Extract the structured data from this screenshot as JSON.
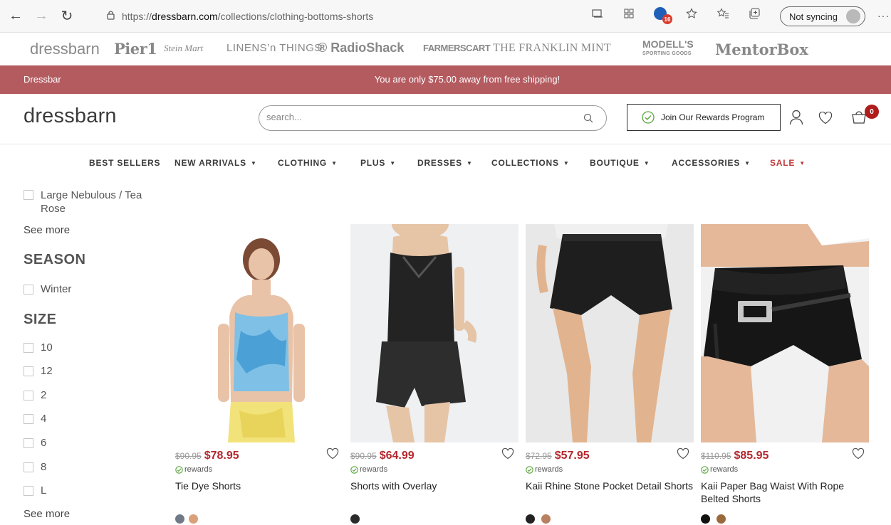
{
  "browser": {
    "url_prefix": "https://",
    "url_domain": "dressbarn.com",
    "url_path": "/collections/clothing-bottoms-shorts",
    "extension_badge": "16",
    "sync_label": "Not syncing",
    "more": "···"
  },
  "brands": [
    "dressbarn",
    "Pier1",
    "Stein Mart",
    "LINENS’n THINGS",
    "® RadioShack",
    "FARMERSCART",
    "THE FRANKLIN MINT",
    "MODELL'S",
    "MentorBox"
  ],
  "brands_sub": {
    "modells": "SPORTING GOODS"
  },
  "promo": {
    "left": "Dressbar",
    "center": "You are only $75.00 away from free shipping!"
  },
  "header": {
    "logo": "dressbarn",
    "search_placeholder": "search...",
    "rewards_label": "Join Our Rewards Program",
    "cart_count": "0"
  },
  "nav": [
    {
      "label": "BEST SELLERS",
      "caret": ""
    },
    {
      "label": "NEW ARRIVALS",
      "caret": "▼"
    },
    {
      "label": "CLOTHING",
      "caret": "▼"
    },
    {
      "label": "PLUS",
      "caret": "▼"
    },
    {
      "label": "DRESSES",
      "caret": "▼"
    },
    {
      "label": "COLLECTIONS",
      "caret": "▼"
    },
    {
      "label": "BOUTIQUE",
      "caret": "▼"
    },
    {
      "label": "ACCESSORIES",
      "caret": "▼"
    },
    {
      "label": "SALE",
      "caret": "▼"
    }
  ],
  "filters": {
    "color_option": "Large Nebulous / Tea Rose",
    "see_more_1": "See more",
    "season_heading": "SEASON",
    "season_options": [
      "Winter"
    ],
    "size_heading": "SIZE",
    "size_options": [
      "10",
      "12",
      "2",
      "4",
      "6",
      "8",
      "L"
    ],
    "see_more_2": "See more"
  },
  "products": [
    {
      "name": "Tie Dye Shorts",
      "old_price": "$90.95",
      "price": "$78.95",
      "rewards": "rewards",
      "swatches": [
        "#6f7a86",
        "#d9a07a"
      ]
    },
    {
      "name": "Shorts with Overlay",
      "old_price": "$90.95",
      "price": "$64.99",
      "rewards": "rewards",
      "swatches": [
        "#2b2b2b"
      ]
    },
    {
      "name": "Kaii Rhine Stone Pocket Detail Shorts",
      "old_price": "$72.95",
      "price": "$57.95",
      "rewards": "rewards",
      "swatches": [
        "#222222",
        "#b88060"
      ]
    },
    {
      "name": "Kaii Paper Bag Waist With Rope Belted Shorts",
      "old_price": "$110.95",
      "price": "$85.95",
      "rewards": "rewards",
      "swatches": [
        "#111111",
        "#9a6a3c"
      ]
    }
  ],
  "colors": {
    "promo_bg": "#b45b60",
    "sale_price": "#b4272c",
    "rewards_green": "#5aa53b",
    "cart_badge": "#b01c1c"
  }
}
